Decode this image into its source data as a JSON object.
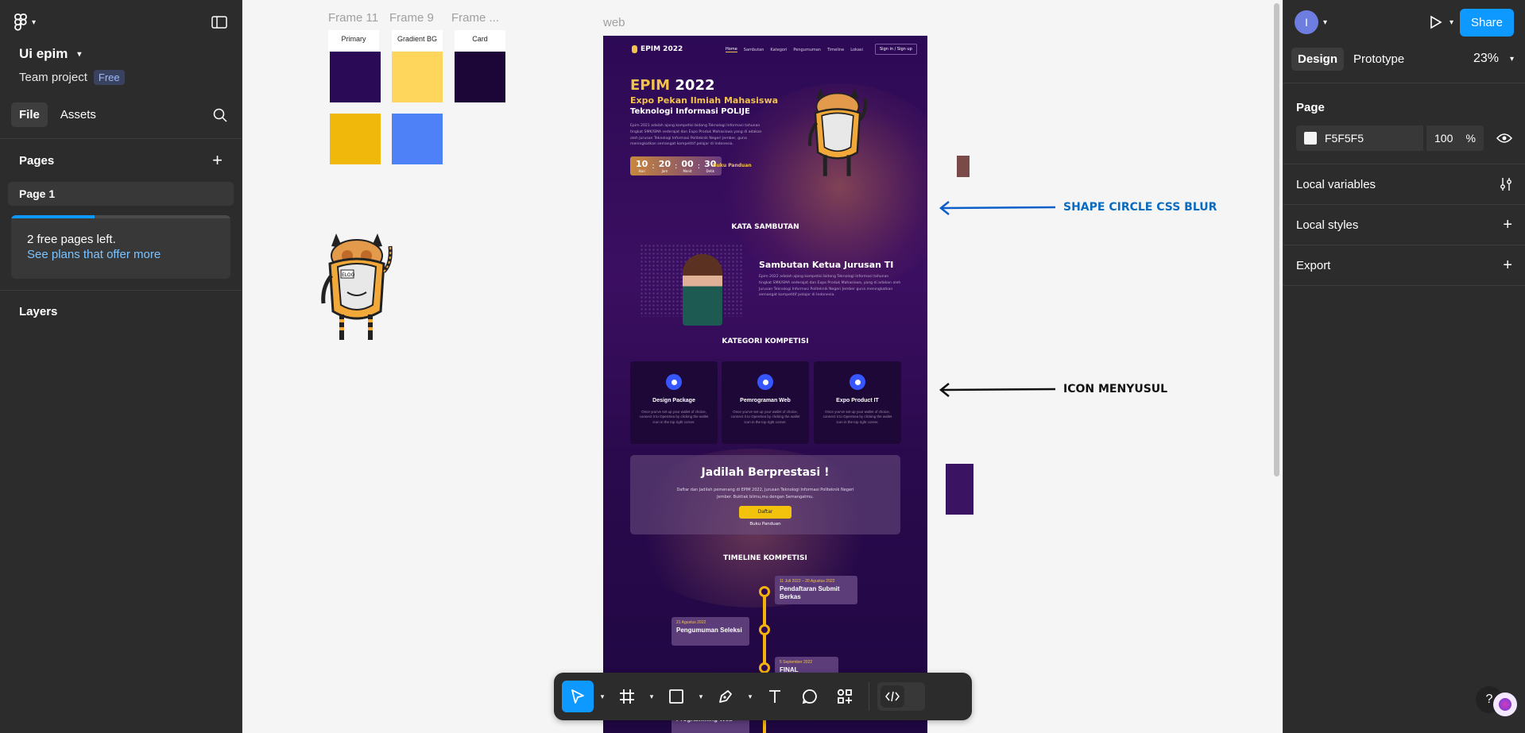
{
  "left_panel": {
    "project_name": "Ui epim",
    "team": "Team project",
    "plan_badge": "Free",
    "tabs": [
      {
        "label": "File",
        "active": true
      },
      {
        "label": "Assets",
        "active": false
      }
    ],
    "pages_header": "Pages",
    "pages": [
      {
        "label": "Page 1"
      }
    ],
    "free_notice": "2 free pages left.",
    "plans_link": "See plans that offer more",
    "layers_header": "Layers"
  },
  "right_panel": {
    "avatar_letter": "I",
    "share_label": "Share",
    "tabs": [
      {
        "label": "Design",
        "active": true
      },
      {
        "label": "Prototype",
        "active": false
      }
    ],
    "zoom": "23%",
    "page_header": "Page",
    "page_color": "F5F5F5",
    "opacity": "100",
    "opacity_unit": "%",
    "sections": [
      "Local variables",
      "Local styles",
      "Export"
    ]
  },
  "canvas": {
    "frame_labels": [
      "Frame 11",
      "Frame 9",
      "Frame ...",
      "web"
    ],
    "swatch_titles": [
      "Primary",
      "Gradient BG",
      "Card"
    ],
    "colors": {
      "primary": "#2a0a57",
      "gradient": "#ffd65c",
      "card": "#1c0637",
      "yellow": "#f1b80c",
      "blue": "#4e80f8",
      "brown": "#7a4a48",
      "purple": "#3a1463"
    },
    "annotations": [
      {
        "text": "SHAPE CIRCLE CSS BLUR",
        "color": "#0a6bbf"
      },
      {
        "text": "ICON MENYUSUL",
        "color": "#111111"
      }
    ]
  },
  "web": {
    "logo": "EPIM 2022",
    "nav": [
      "Home",
      "Sambutan",
      "Kategori",
      "Pengumuman",
      "Timeline",
      "Lokasi"
    ],
    "signin": "Sign in / Sign up",
    "hero_year_a": "EPIM",
    "hero_year_b": "2022",
    "hero_subtitle": "Expo Pekan Ilmiah Mahasiswa",
    "hero_subtitle2": "Teknologi Informasi POLIJE",
    "hero_text": "Epim 2021 adalah ajang kompetisi bidang Teknologi Informasi tahunan tingkat SMK/SMA sederajat dan Expo Produk Mahasiswa yang di adakan oleh Jurusan Teknologi Informasi Politeknik Negeri Jember, guna meningkatkan semangat kompetitif pelajar di Indonesia.",
    "countdown": [
      {
        "v": "10",
        "l": "Hari"
      },
      {
        "v": "20",
        "l": "Jam"
      },
      {
        "v": "00",
        "l": "Menit"
      },
      {
        "v": "30",
        "l": "Detik"
      }
    ],
    "buku": "Buku Panduan",
    "kata": "KATA SAMBUTAN",
    "sambutan_title": "Sambutan Ketua Jurusan TI",
    "sambutan_text": "Epim 2022 adalah ajang kompetisi bidang Teknologi Informasi tahunan tingkat SMK/SMA sederajat dan Expo Produk Mahasiswa, yang di adakan oleh Jurusan Teknologi Informasi Politeknik Negeri Jember guna meningkatkan semangat kompetitif pelajar di Indonesia.",
    "kategori": "KATEGORI KOMPETISI",
    "cards": [
      {
        "title": "Design Package",
        "desc": "Once you've set up your wallet of choice, connect it to OpenSea by clicking the wallet icon in the top right corner."
      },
      {
        "title": "Pemrograman Web",
        "desc": "Once you've set up your wallet of choice, connect it to OpenSea by clicking the wallet icon in the top right corner."
      },
      {
        "title": "Expo Product IT",
        "desc": "Once you've set up your wallet of choice, connect it to OpenSea by clicking the wallet icon in the top right corner."
      }
    ],
    "cta_title": "Jadilah Berprestasi !",
    "cta_text": "Daftar dan Jadilah pemenang di EPIM 2022, Jurusan Teknologi Informasi Politeknik Negeri Jember. Buktiak bilmu,mu dengan Semangatmu.",
    "cta_button": "Daftar",
    "cta_link": "Buku Panduan",
    "timeline_title": "TIMELINE KOMPETISI",
    "timeline": [
      {
        "date": "11 Juli 2022 – 20 Agustus 2022",
        "title": "Pendaftaran Submit Berkas"
      },
      {
        "date": "21 Agustus 2022",
        "title": "Pengumuman Seleksi"
      },
      {
        "date": "5 September 2022",
        "title": "FINAL"
      },
      {
        "date": "",
        "title": "Programming Web"
      }
    ]
  },
  "toolbar": {
    "tools": [
      "move-tool",
      "frame-tool",
      "shape-tool",
      "pen-tool",
      "text-tool",
      "comment-tool",
      "actions-tool",
      "dev-mode-toggle"
    ]
  }
}
